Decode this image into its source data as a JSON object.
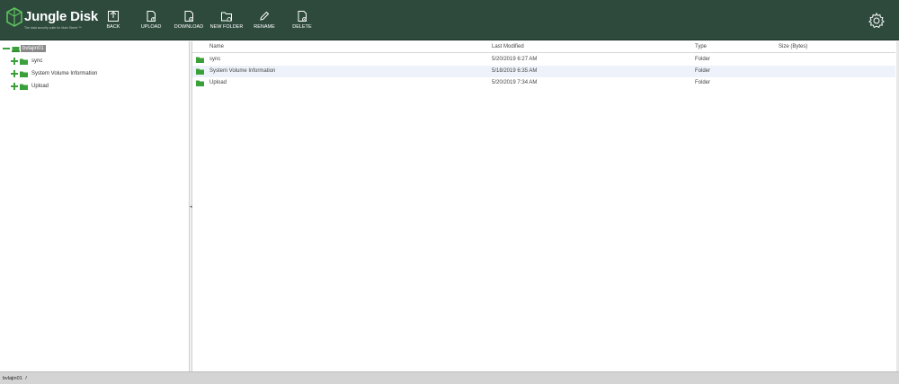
{
  "header": {
    "brand_name": "Jungle Disk",
    "brand_tagline": "The data security suite for Main Street ™",
    "toolbar": [
      {
        "id": "back",
        "label": "BACK",
        "icon": "back-icon"
      },
      {
        "id": "upload",
        "label": "UPLOAD",
        "icon": "upload-icon"
      },
      {
        "id": "download",
        "label": "DOWNLOAD",
        "icon": "download-icon"
      },
      {
        "id": "new_folder",
        "label": "NEW FOLDER",
        "icon": "new-folder-icon"
      },
      {
        "id": "rename",
        "label": "RENAME",
        "icon": "pencil-icon"
      },
      {
        "id": "delete",
        "label": "DELETE",
        "icon": "delete-icon"
      }
    ],
    "settings_icon": "gear-icon"
  },
  "tree": {
    "root": {
      "label": "bvlajin01",
      "icon": "drive-icon"
    },
    "children": [
      {
        "label": "sync",
        "icon": "folder-icon"
      },
      {
        "label": "System Volume Information",
        "icon": "folder-icon"
      },
      {
        "label": "Upload",
        "icon": "folder-icon"
      }
    ]
  },
  "list": {
    "columns": {
      "name": "Name",
      "modified": "Last Modified",
      "type": "Type",
      "size": "Size (Bytes)"
    },
    "rows": [
      {
        "name": "sync",
        "modified": "5/20/2019 6:27 AM",
        "type": "Folder",
        "size": ""
      },
      {
        "name": "System Volume Information",
        "modified": "5/18/2019 6:35 AM",
        "type": "Folder",
        "size": ""
      },
      {
        "name": "Upload",
        "modified": "5/20/2019 7:34 AM",
        "type": "Folder",
        "size": ""
      }
    ]
  },
  "status": {
    "path": "bvlajin01",
    "separator": "/"
  },
  "colors": {
    "header_bg": "#2e4a3d",
    "accent_green": "#3aa03a",
    "selected_row": "#eef3fb"
  }
}
